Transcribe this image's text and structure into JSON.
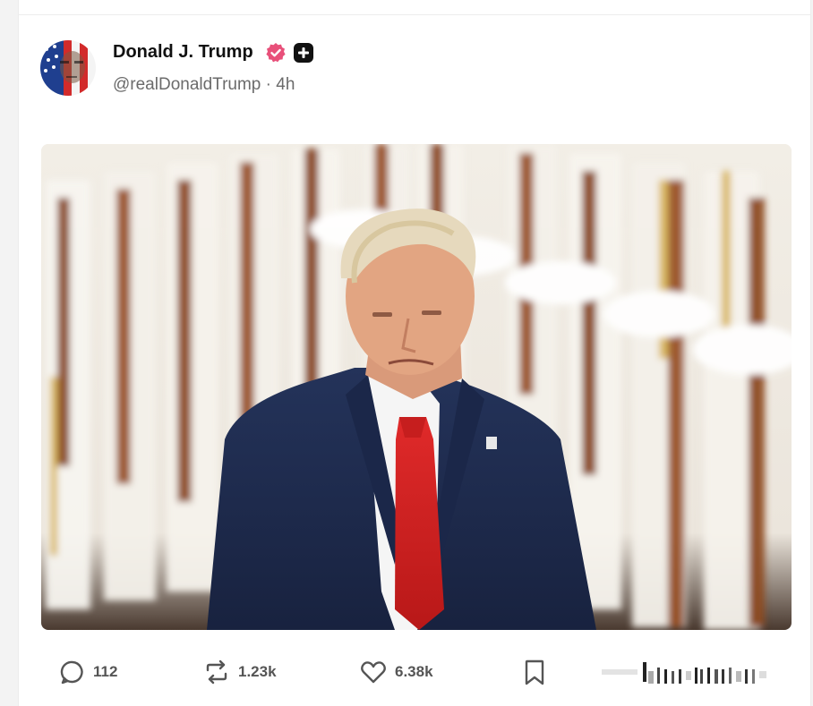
{
  "post": {
    "author": {
      "display_name": "Donald J. Trump",
      "handle": "@realDonaldTrump",
      "separator": "·",
      "time": "4h"
    },
    "badges": {
      "verified_icon": "verified-badge-icon",
      "plus_icon": "plus-badge-icon",
      "verified_color": "#e8507a"
    },
    "image": {
      "icon": "post-photo"
    },
    "actions": {
      "replies": "112",
      "reposts": "1.23k",
      "likes": "6.38k",
      "reply_icon": "comment-icon",
      "repost_icon": "repost-icon",
      "like_icon": "heart-icon",
      "bookmark_icon": "bookmark-icon"
    }
  },
  "colors": {
    "text_primary": "#111111",
    "text_secondary": "#6b6b6b",
    "icon": "#555555",
    "background": "#ffffff"
  }
}
